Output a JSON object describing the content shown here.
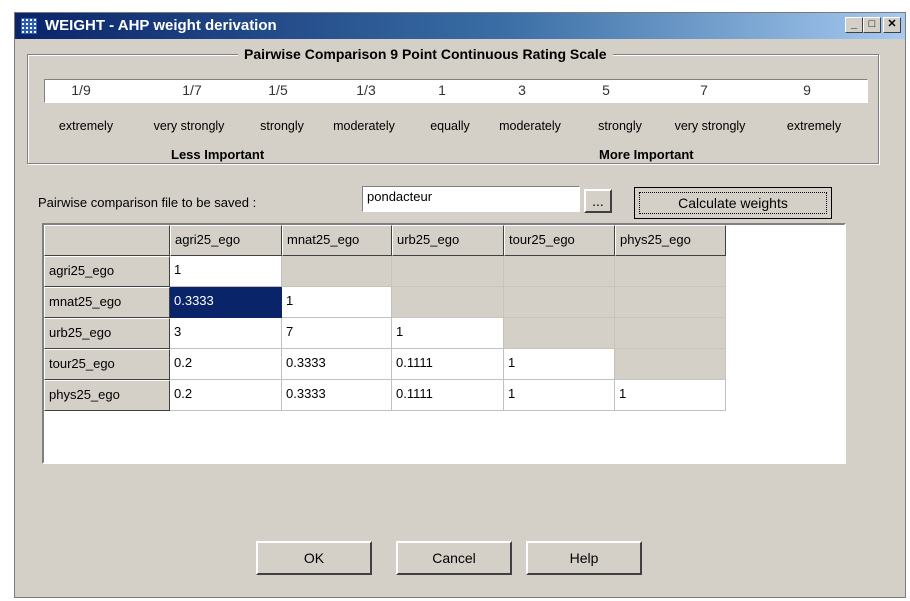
{
  "window": {
    "title": "WEIGHT - AHP weight derivation",
    "controls": {
      "minimize": "_",
      "maximize": "□",
      "close": "✕"
    }
  },
  "scale": {
    "title": "Pairwise Comparison 9 Point Continuous Rating Scale",
    "values": [
      "1/9",
      "1/7",
      "1/5",
      "1/3",
      "1",
      "3",
      "5",
      "7",
      "9"
    ],
    "labels": [
      "extremely",
      "very strongly",
      "strongly",
      "moderately",
      "equally",
      "moderately",
      "strongly",
      "very strongly",
      "extremely"
    ],
    "less_important": "Less Important",
    "more_important": "More Important"
  },
  "file": {
    "label": "Pairwise comparison file to be saved :",
    "value": "pondacteur",
    "browse_label": "..."
  },
  "calculate_label": "Calculate weights",
  "matrix": {
    "columns": [
      "agri25_ego",
      "mnat25_ego",
      "urb25_ego",
      "tour25_ego",
      "phys25_ego"
    ],
    "rows": [
      {
        "label": "agri25_ego",
        "cells": [
          "1",
          "",
          "",
          "",
          ""
        ]
      },
      {
        "label": "mnat25_ego",
        "cells": [
          "0.3333",
          "1",
          "",
          "",
          ""
        ]
      },
      {
        "label": "urb25_ego",
        "cells": [
          "3",
          "7",
          "1",
          "",
          ""
        ]
      },
      {
        "label": "tour25_ego",
        "cells": [
          "0.2",
          "0.3333",
          "0.1111",
          "1",
          ""
        ]
      },
      {
        "label": "phys25_ego",
        "cells": [
          "0.2",
          "0.3333",
          "0.1111",
          "1",
          "1"
        ]
      }
    ],
    "selected_cell": "mnat25_ego / agri25_ego"
  },
  "buttons": {
    "ok": "OK",
    "cancel": "Cancel",
    "help": "Help"
  }
}
